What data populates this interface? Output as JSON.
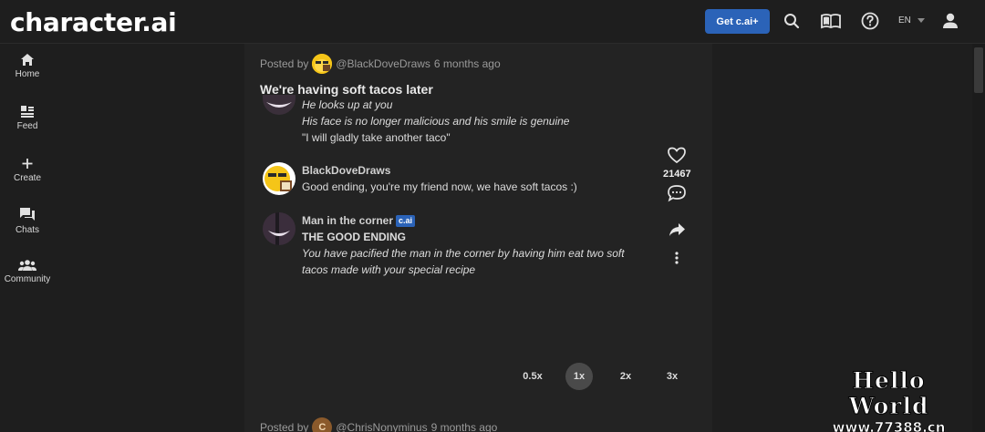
{
  "header": {
    "logo": "character.ai",
    "get_plus": "Get c.ai+",
    "language": "EN",
    "icons": [
      "search-icon",
      "book-icon",
      "help-icon",
      "profile-icon"
    ]
  },
  "sidebar": {
    "items": [
      {
        "label": "Home",
        "icon": "home-icon"
      },
      {
        "label": "Feed",
        "icon": "feed-icon"
      },
      {
        "label": "Create",
        "icon": "plus-icon"
      },
      {
        "label": "Chats",
        "icon": "chat-icon"
      },
      {
        "label": "Community",
        "icon": "community-icon"
      }
    ]
  },
  "post": {
    "posted_by": "Posted by",
    "author": "@BlackDoveDraws",
    "time": "6 months ago",
    "title": "We're having soft tacos later",
    "partial_lines": [
      "He looks up at you",
      "His face is no longer malicious and his smile is genuine",
      "\"I will gladly take another taco\""
    ],
    "messages": [
      {
        "name": "BlackDoveDraws",
        "text": "Good ending, you're my friend now, we have soft tacos :)"
      },
      {
        "name": "Man in the corner",
        "badge": "c.ai",
        "heading": "THE GOOD ENDING",
        "text": "You have pacified the man in the corner by having him eat two soft tacos made with your special recipe"
      }
    ],
    "likes": "21467",
    "actions": [
      "heart-icon",
      "comment-icon",
      "share-icon",
      "more-icon"
    ]
  },
  "playback": {
    "speeds": [
      "0.5x",
      "1x",
      "2x",
      "3x"
    ],
    "active": "1x"
  },
  "next_post": {
    "posted_by": "Posted by",
    "avatar_letter": "C",
    "author": "@ChrisNonyminus",
    "time": "9 months ago"
  },
  "watermark": {
    "title": "Hello World",
    "url": "www.77388.cn"
  },
  "colors": {
    "background": "#1e1e1e",
    "feed_panel": "#232323",
    "accent": "#2b63b8"
  }
}
